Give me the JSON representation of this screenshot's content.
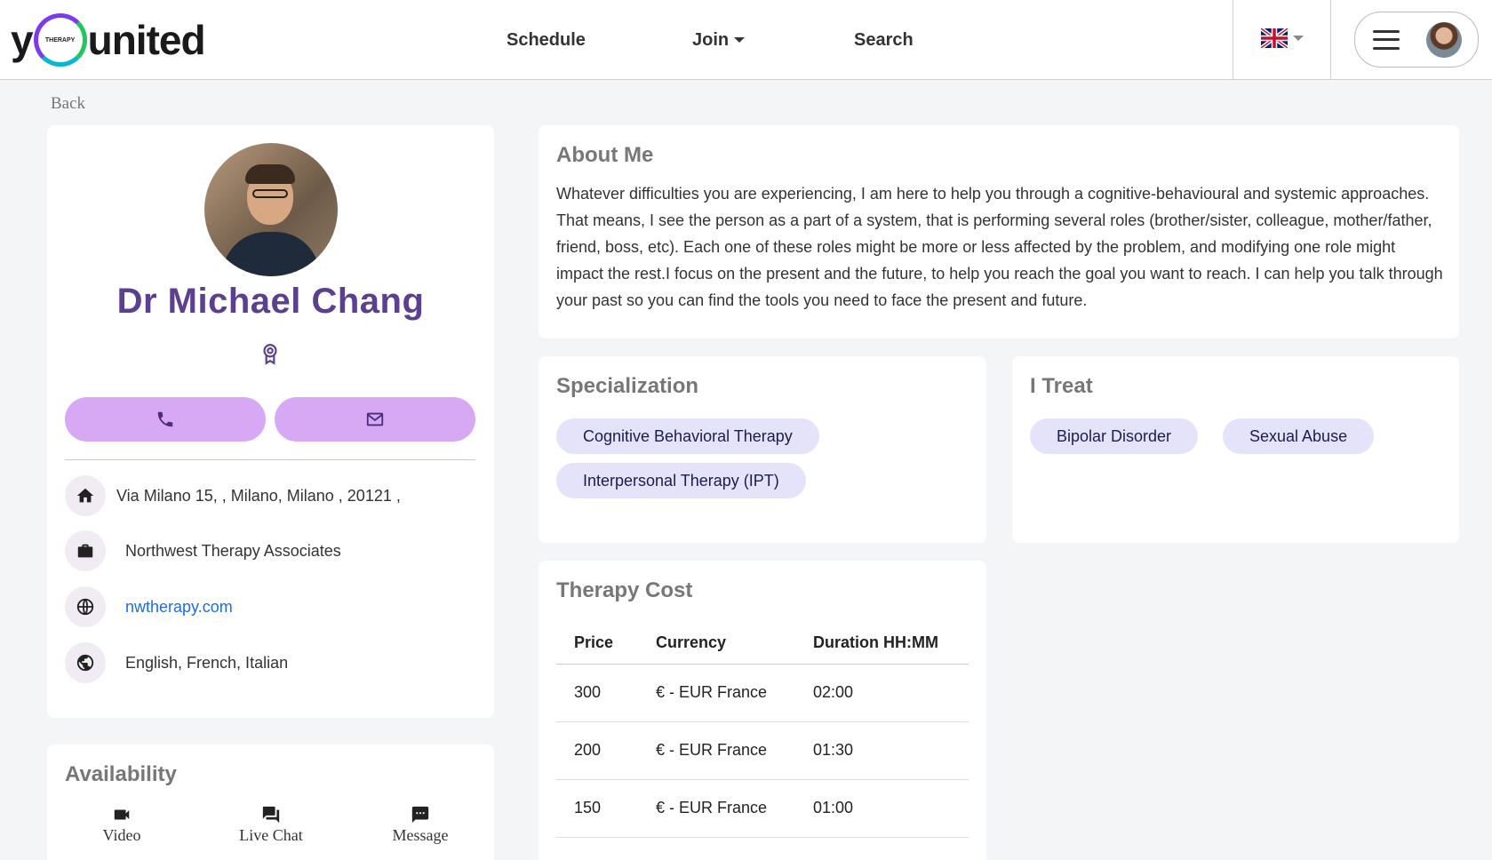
{
  "header": {
    "logo_pre": "y",
    "logo_ring": "THERAPY",
    "logo_post": "united",
    "nav": {
      "schedule": "Schedule",
      "join": "Join",
      "search": "Search"
    },
    "language_icon": "uk-flag-icon",
    "menu_icon": "hamburger-icon"
  },
  "back_label": "Back",
  "profile": {
    "name": "Dr Michael Chang",
    "badge_icon": "award-ribbon-icon",
    "call_icon": "phone-icon",
    "email_icon": "mail-icon",
    "address": "Via Milano 15, , Milano, Milano , 20121 ,",
    "company": "Northwest Therapy Associates",
    "website": "nwtherapy.com",
    "languages": "English, French, Italian"
  },
  "availability": {
    "title": "Availability",
    "items": [
      "Video",
      "Live Chat",
      "Message"
    ]
  },
  "about": {
    "title": "About Me",
    "text": "Whatever difficulties you are experiencing, I am here to help you through a cognitive-behavioural and systemic approaches. That means, I see the person as a part of a system, that is performing several roles (brother/sister, colleague, mother/father, friend, boss, etc). Each one of these roles might be more or less affected by the problem, and modifying one role might impact the rest.I focus on the present and the future, to help you reach the goal you want to reach. I can help you talk through your past so you can find the tools you need to face the present and future."
  },
  "specialization": {
    "title": "Specialization",
    "chips": [
      "Cognitive Behavioral Therapy",
      "Interpersonal Therapy (IPT)"
    ]
  },
  "treat": {
    "title": "I Treat",
    "chips": [
      "Bipolar Disorder",
      "Sexual Abuse"
    ]
  },
  "cost": {
    "title": "Therapy Cost",
    "headers": [
      "Price",
      "Currency",
      "Duration HH:MM"
    ],
    "rows": [
      [
        "300",
        "€ - EUR France",
        "02:00"
      ],
      [
        "200",
        "€ - EUR France",
        "01:30"
      ],
      [
        "150",
        "€ - EUR France",
        "01:00"
      ]
    ]
  },
  "colors": {
    "accent": "#5b3f91",
    "button": "#d7a8f3",
    "chip": "#e5e3fa",
    "link": "#1a6fe0"
  }
}
